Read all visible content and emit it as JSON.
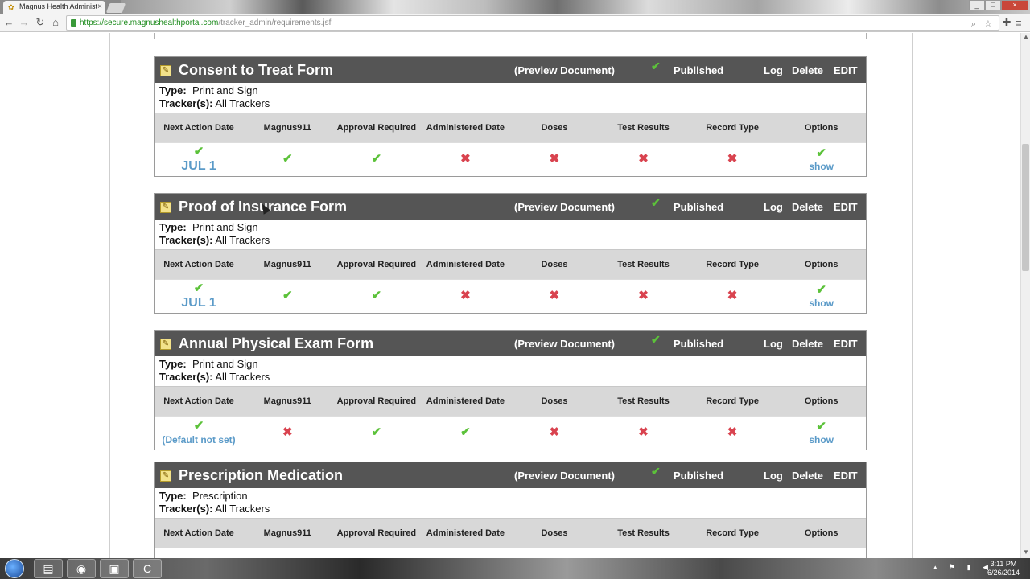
{
  "browser": {
    "tab_title": "Magnus Health Administ",
    "tab_close": "×",
    "url_host": "https://secure.magnushealthportal.com",
    "url_path": "/tracker_admin/requirements.jsf",
    "icons": [
      "back-icon",
      "forward-icon",
      "reload-icon",
      "home-icon",
      "zoom-icon",
      "star-icon",
      "extensions-icon",
      "menu-icon"
    ]
  },
  "table_headers": {
    "next_action": "Next Action Date",
    "magnus911": "Magnus911",
    "approval": "Approval Required",
    "administered": "Administered Date",
    "doses": "Doses",
    "test_results": "Test Results",
    "record_type": "Record Type",
    "options": "Options"
  },
  "labels": {
    "preview": "(Preview Document)",
    "published": "Published",
    "log": "Log",
    "delete": "Delete",
    "edit": "EDIT",
    "type_key": "Type:",
    "trackers_key": "Tracker(s):",
    "show": "show"
  },
  "requirements": [
    {
      "title": "Consent to Treat Form",
      "type": "Print and Sign",
      "trackers": "All Trackers",
      "next_action_date": "JUL 1",
      "magnus911": true,
      "approval": true,
      "administered": false,
      "doses": false,
      "test_results": false,
      "record_type": false
    },
    {
      "title": "Proof of Insurance Form",
      "type": "Print and Sign",
      "trackers": "All Trackers",
      "next_action_date": "JUL 1",
      "magnus911": true,
      "approval": true,
      "administered": false,
      "doses": false,
      "test_results": false,
      "record_type": false
    },
    {
      "title": "Annual Physical Exam Form",
      "type": "Print and Sign",
      "trackers": "All Trackers",
      "next_action_date": "(Default not set)",
      "magnus911": false,
      "approval": true,
      "administered": true,
      "doses": false,
      "test_results": false,
      "record_type": false
    },
    {
      "title": "Prescription Medication",
      "type": "Prescription",
      "trackers": "All Trackers"
    }
  ],
  "taskbar": {
    "time": "3:11 PM",
    "date": "6/26/2014"
  },
  "colors": {
    "header_bg": "#555555",
    "check": "#5cc23a",
    "cross": "#d9434f",
    "link": "#5a9ac8"
  }
}
